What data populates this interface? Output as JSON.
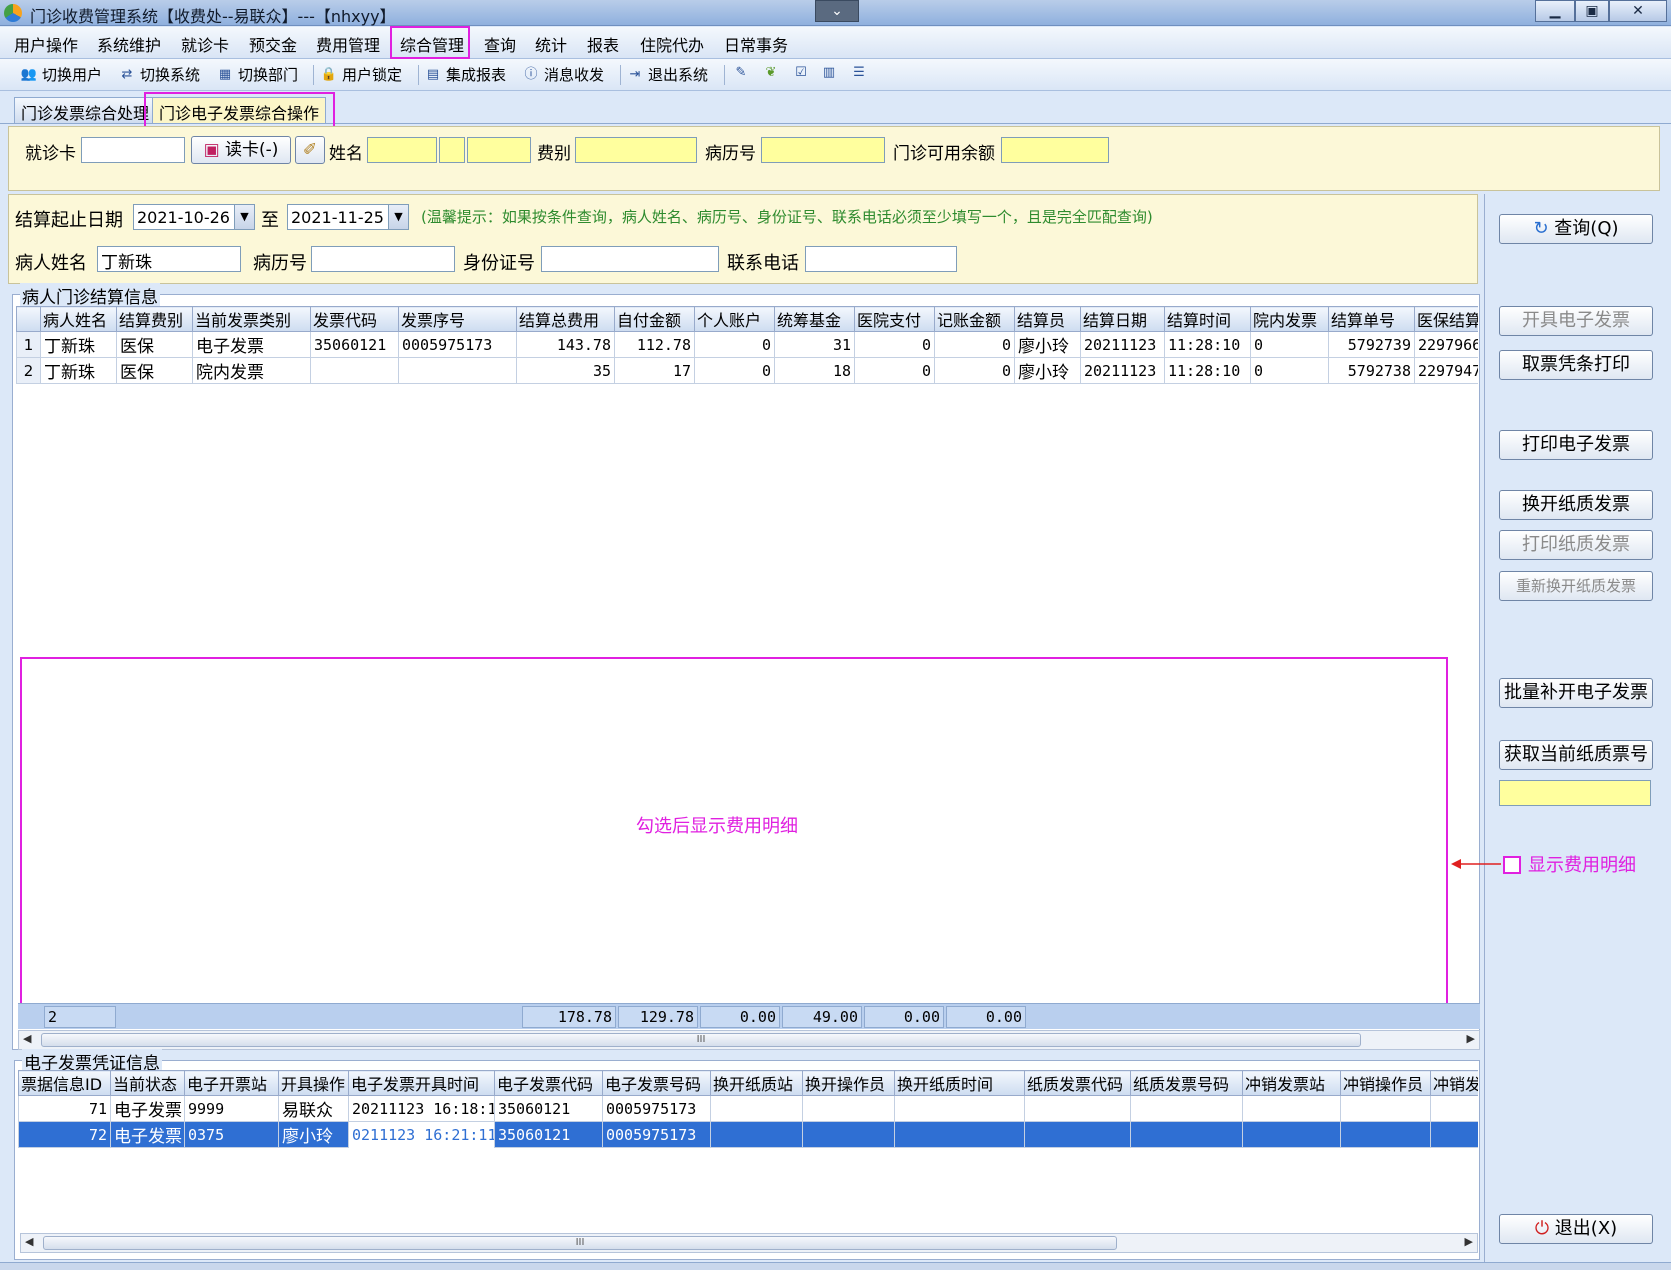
{
  "window": {
    "title": "门诊收费管理系统【收费处--易联众】---【nhxyy】",
    "dropdown": "⌄",
    "min": "▁",
    "max": "▣",
    "close": "✕"
  },
  "menu": [
    "用户操作",
    "系统维护",
    "就诊卡",
    "预交金",
    "费用管理",
    "综合管理",
    "查询",
    "统计",
    "报表",
    "住院代办",
    "日常事务"
  ],
  "toolbar": [
    "切换用户",
    "切换系统",
    "切换部门",
    "用户锁定",
    "集成报表",
    "消息收发",
    "退出系统"
  ],
  "tabs": [
    "门诊发票综合处理",
    "门诊电子发票综合操作"
  ],
  "patient": {
    "card_label": "就诊卡",
    "card_value": "",
    "read_card_btn": "读卡(-)",
    "name_label": "姓名",
    "fee_label": "费别",
    "record_label": "病历号",
    "balance_label": "门诊可用余额"
  },
  "query": {
    "date_label": "结算起止日期",
    "date_from": "2021-10-26",
    "to_label": "至",
    "date_to": "2021-11-25",
    "hint": "(温馨提示：如果按条件查询，病人姓名、病历号、身份证号、联系电话必须至少填写一个，且是完全匹配查询)",
    "name_label": "病人姓名",
    "name_value": "丁新珠",
    "record_label": "病历号",
    "id_label": "身份证号",
    "phone_label": "联系电话"
  },
  "settle": {
    "title": "病人门诊结算信息",
    "columns": [
      "",
      "病人姓名",
      "结算费别",
      "当前发票类别",
      "发票代码",
      "发票序号",
      "结算总费用",
      "自付金额",
      "个人账户",
      "统筹基金",
      "医院支付",
      "记账金额",
      "结算员",
      "结算日期",
      "结算时间",
      "院内发票",
      "结算单号",
      "医保结算"
    ],
    "rows": [
      [
        "1",
        "丁新珠",
        "医保",
        "电子发票",
        "35060121",
        "0005975173",
        "143.78",
        "112.78",
        "0",
        "31",
        "0",
        "0",
        "廖小玲",
        "20211123",
        "11:28:10",
        "0",
        "5792739",
        "2297966"
      ],
      [
        "2",
        "丁新珠",
        "医保",
        "院内发票",
        "",
        "",
        "35",
        "17",
        "0",
        "18",
        "0",
        "0",
        "廖小玲",
        "20211123",
        "11:28:10",
        "0",
        "5792738",
        "2297947"
      ]
    ],
    "totals": {
      "count": "2",
      "total": "178.78",
      "self": "129.78",
      "personal": "0.00",
      "fund": "49.00",
      "hospital": "0.00",
      "account": "0.00"
    },
    "scroll_grip": "III"
  },
  "voucher": {
    "title": "电子发票凭证信息",
    "columns": [
      "票据信息ID",
      "当前状态",
      "电子开票站",
      "开具操作",
      "电子发票开具时间",
      "电子发票代码",
      "电子发票号码",
      "换开纸质站",
      "换开操作员",
      "换开纸质时间",
      "纸质发票代码",
      "纸质发票号码",
      "冲销发票站",
      "冲销操作员",
      "冲销发"
    ],
    "rows": [
      [
        "71",
        "电子发票",
        "9999",
        "易联众",
        "20211123 16:18:1",
        "35060121",
        "0005975173",
        "",
        "",
        "",
        "",
        "",
        "",
        "",
        ""
      ],
      [
        "72",
        "电子发票",
        "0375",
        "廖小玲",
        "0211123 16:21:11",
        "35060121",
        "0005975173",
        "",
        "",
        "",
        "",
        "",
        "",
        "",
        ""
      ]
    ],
    "scroll_grip": "III"
  },
  "right_buttons": {
    "query": "查询(Q)",
    "issue": "开具电子发票",
    "voucher_print": "取票凭条打印",
    "print_e": "打印电子发票",
    "swap_paper": "换开纸质发票",
    "print_paper": "打印纸质发票",
    "reswap_paper": "重新换开纸质发票",
    "batch_issue": "批量补开电子发票",
    "get_paper_no": "获取当前纸质票号",
    "exit": "退出(X)"
  },
  "annotation": {
    "center_text": "勾选后显示费用明细",
    "checkbox_label": "显示费用明细"
  },
  "colors": {
    "highlight": "#e020e0",
    "selected_row": "#2f6fd3",
    "yellow_field": "#ffff9e"
  }
}
